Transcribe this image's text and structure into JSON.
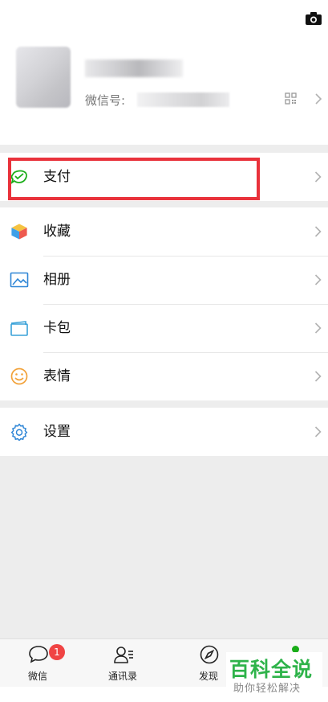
{
  "profile": {
    "wxid_label": "微信号:"
  },
  "menu": {
    "pay": "支付",
    "favorites": "收藏",
    "album": "相册",
    "cards": "卡包",
    "stickers": "表情",
    "settings": "设置"
  },
  "tabbar": {
    "chats": "微信",
    "chats_badge": "1",
    "contacts": "通讯录",
    "discover": "发现"
  },
  "watermark": {
    "title": "百科全说",
    "subtitle": "助你轻松解决"
  },
  "colors": {
    "highlight": "#e9323b",
    "pay_green": "#1aad19",
    "badge": "#f04444"
  }
}
